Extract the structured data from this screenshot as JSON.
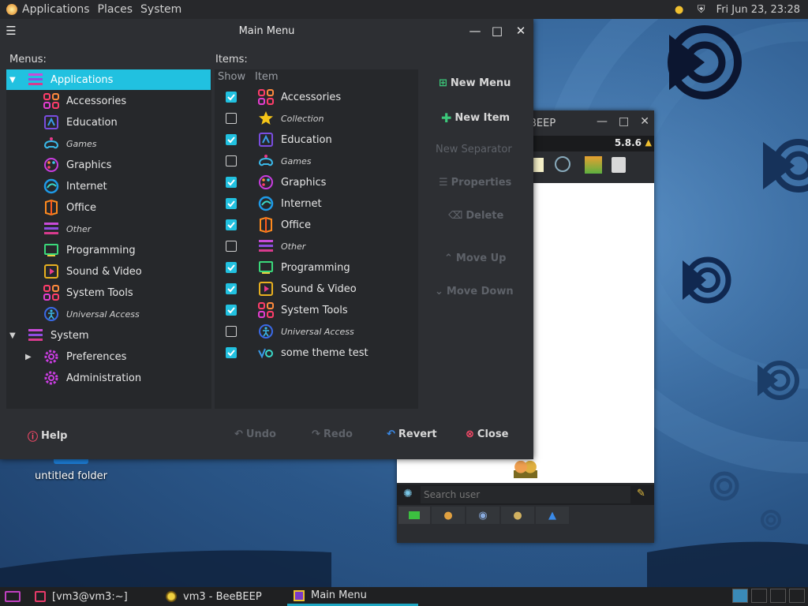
{
  "top_panel": {
    "menus": [
      "Applications",
      "Places",
      "System"
    ],
    "clock": "Fri Jun 23, 23:28"
  },
  "desktop": {
    "folder_label": "untitled folder"
  },
  "beebeep": {
    "title": "eBEEP",
    "version": "5.8.6",
    "search_placeholder": "Search user"
  },
  "main_menu": {
    "title": "Main Menu",
    "menus_label": "Menus:",
    "items_label": "Items:",
    "col_show": "Show",
    "col_item": "Item",
    "tree": [
      {
        "label": "Applications",
        "level": 0,
        "icon": "menu-icon",
        "italic": false,
        "selected": true,
        "expander": "open"
      },
      {
        "label": "Accessories",
        "level": 1,
        "icon": "accessories-icon",
        "italic": false
      },
      {
        "label": "Education",
        "level": 1,
        "icon": "education-icon",
        "italic": false
      },
      {
        "label": "Games",
        "level": 1,
        "icon": "games-icon",
        "italic": true
      },
      {
        "label": "Graphics",
        "level": 1,
        "icon": "graphics-icon",
        "italic": false
      },
      {
        "label": "Internet",
        "level": 1,
        "icon": "internet-icon",
        "italic": false
      },
      {
        "label": "Office",
        "level": 1,
        "icon": "office-icon",
        "italic": false
      },
      {
        "label": "Other",
        "level": 1,
        "icon": "menu-icon",
        "italic": true
      },
      {
        "label": "Programming",
        "level": 1,
        "icon": "programming-icon",
        "italic": false
      },
      {
        "label": "Sound & Video",
        "level": 1,
        "icon": "sound-video-icon",
        "italic": false
      },
      {
        "label": "System Tools",
        "level": 1,
        "icon": "system-tools-icon",
        "italic": false
      },
      {
        "label": "Universal Access",
        "level": 1,
        "icon": "universal-access-icon",
        "italic": true
      },
      {
        "label": "System",
        "level": 0,
        "icon": "menu-icon",
        "italic": false,
        "expander": "open"
      },
      {
        "label": "Preferences",
        "level": 1,
        "icon": "preferences-icon",
        "italic": false,
        "expander": "closed"
      },
      {
        "label": "Administration",
        "level": 1,
        "icon": "administration-icon",
        "italic": false
      }
    ],
    "items": [
      {
        "label": "Accessories",
        "shown": true,
        "icon": "accessories-icon",
        "italic": false
      },
      {
        "label": "Collection",
        "shown": false,
        "icon": "star-icon",
        "italic": true
      },
      {
        "label": "Education",
        "shown": true,
        "icon": "education-icon",
        "italic": false
      },
      {
        "label": "Games",
        "shown": false,
        "icon": "games-icon",
        "italic": true
      },
      {
        "label": "Graphics",
        "shown": true,
        "icon": "graphics-icon",
        "italic": false
      },
      {
        "label": "Internet",
        "shown": true,
        "icon": "internet-icon",
        "italic": false
      },
      {
        "label": "Office",
        "shown": true,
        "icon": "office-icon",
        "italic": false
      },
      {
        "label": "Other",
        "shown": false,
        "icon": "menu-icon",
        "italic": true
      },
      {
        "label": "Programming",
        "shown": true,
        "icon": "programming-icon",
        "italic": false
      },
      {
        "label": "Sound & Video",
        "shown": true,
        "icon": "sound-video-icon",
        "italic": false
      },
      {
        "label": "System Tools",
        "shown": true,
        "icon": "system-tools-icon",
        "italic": false
      },
      {
        "label": "Universal Access",
        "shown": false,
        "icon": "universal-access-icon",
        "italic": true
      },
      {
        "label": "some theme test",
        "shown": true,
        "icon": "theme-test-icon",
        "italic": false
      }
    ],
    "actions": {
      "new_menu": "New Menu",
      "new_item": "New Item",
      "new_separator": "New Separator",
      "properties": "Properties",
      "delete": "Delete",
      "move_up": "Move Up",
      "move_down": "Move Down"
    },
    "buttons": {
      "help": "Help",
      "undo": "Undo",
      "redo": "Redo",
      "revert": "Revert",
      "close": "Close"
    }
  },
  "taskbar": {
    "tasks": [
      {
        "label": "[vm3@vm3:~]",
        "icon": "terminal-icon",
        "active": false
      },
      {
        "label": "vm3 - BeeBEEP",
        "icon": "bee-icon",
        "active": false
      },
      {
        "label": "Main Menu",
        "icon": "main-menu-icon",
        "active": true
      }
    ]
  },
  "colors": {
    "accent": "#21c1e0",
    "panel": "#27282b",
    "window": "#2d2f33"
  }
}
